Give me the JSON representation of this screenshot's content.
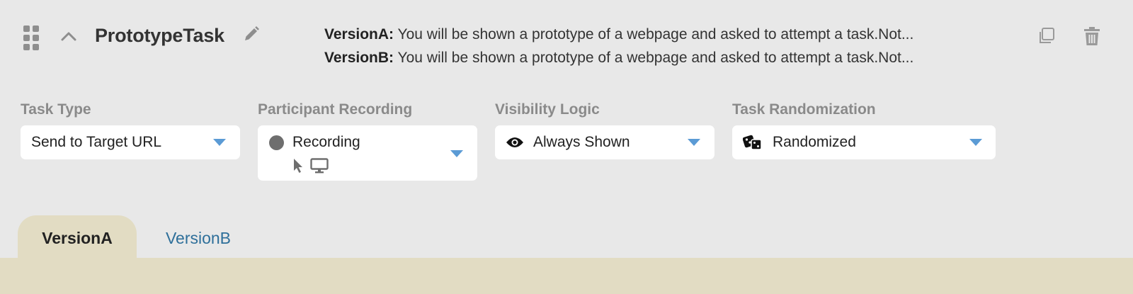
{
  "task": {
    "title": "PrototypeTask"
  },
  "versions_summary": [
    {
      "name": "VersionA:",
      "text": "You will be shown a prototype of a webpage and asked to attempt a task.Not..."
    },
    {
      "name": "VersionB:",
      "text": "You will be shown a prototype of a webpage and asked to attempt a task.Not..."
    }
  ],
  "fields": {
    "task_type": {
      "label": "Task Type",
      "value": "Send to Target URL"
    },
    "participant_recording": {
      "label": "Participant Recording",
      "value": "Recording",
      "sub_icons": [
        "cursor-icon",
        "monitor-icon"
      ]
    },
    "visibility_logic": {
      "label": "Visibility Logic",
      "value": "Always Shown",
      "icon": "eye-icon"
    },
    "task_randomization": {
      "label": "Task Randomization",
      "value": "Randomized",
      "icon": "dice-icon"
    }
  },
  "tabs": [
    {
      "label": "VersionA",
      "active": true
    },
    {
      "label": "VersionB",
      "active": false
    }
  ],
  "colors": {
    "background": "#e8e8e8",
    "accent_caret": "#5b9bd5",
    "active_tab": "#e2dcc3",
    "link_tab": "#2e6f9a",
    "label_gray": "#8a8a8a"
  }
}
